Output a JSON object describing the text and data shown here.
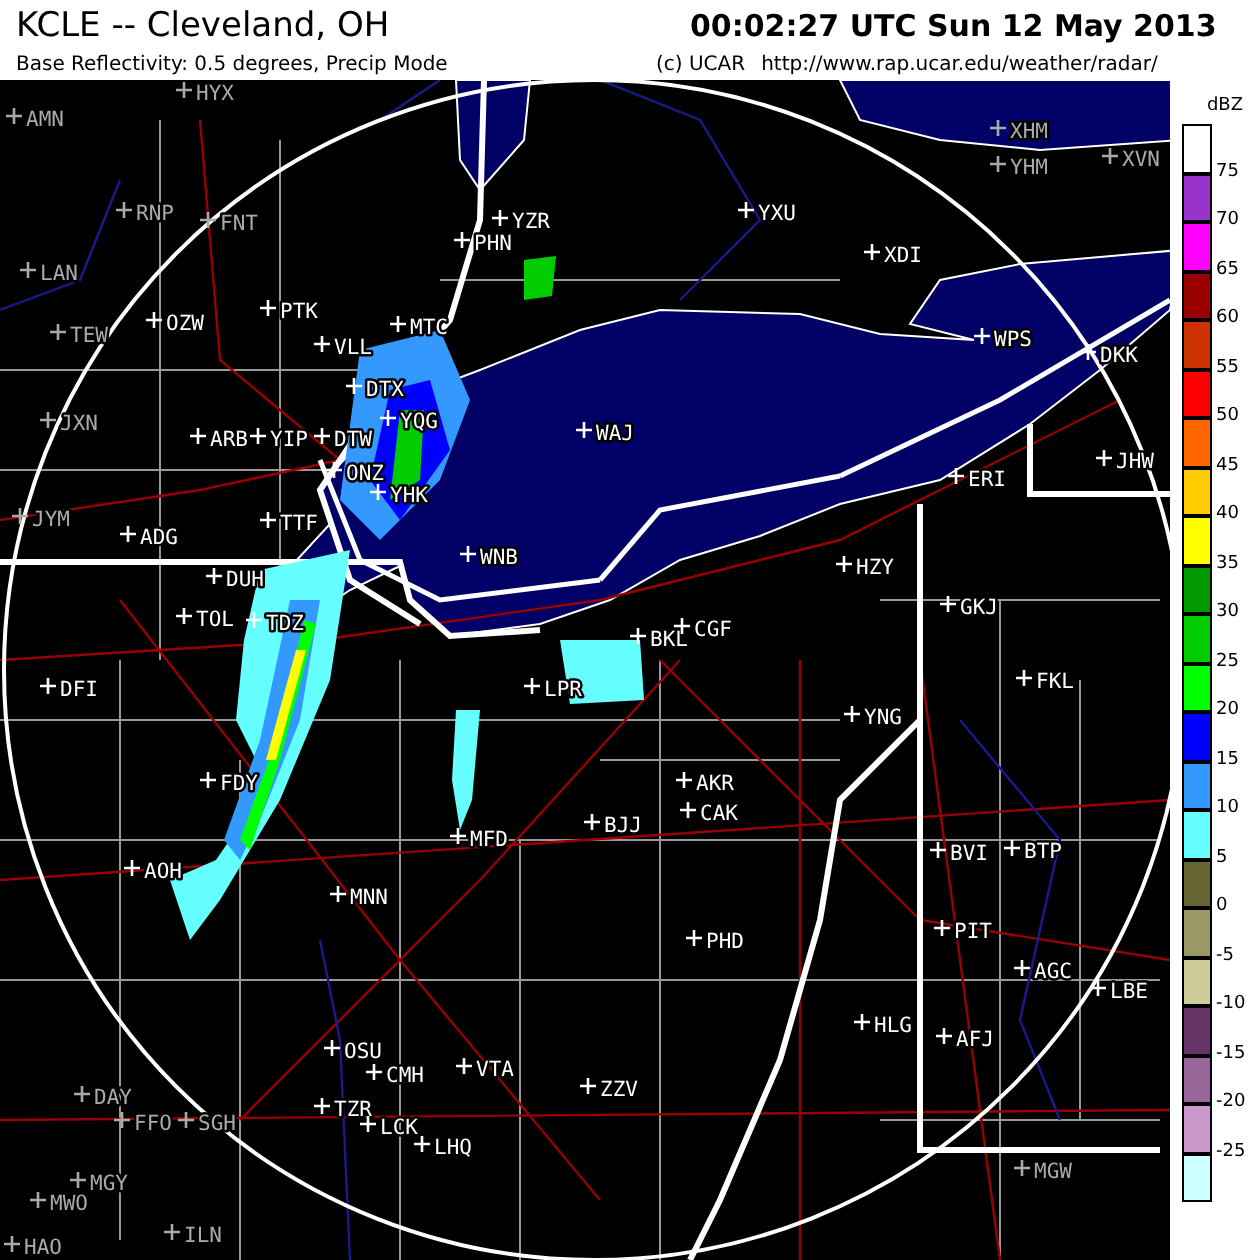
{
  "header": {
    "title": "KCLE -- Cleveland, OH",
    "timestamp": "00:02:27 UTC Sun 12 May 2013",
    "subtitle": "Base Reflectivity: 0.5 degrees, Precip Mode",
    "copyright": "(c) UCAR",
    "url": "http://www.rap.ucar.edu/weather/radar/"
  },
  "stations": [
    "HYX",
    "AMN",
    "RNP",
    "FNT",
    "LAN",
    "PTK",
    "TEW",
    "OZW",
    "VLL",
    "MTC",
    "DTX",
    "JXN",
    "ARB",
    "YIP",
    "DTW",
    "YQG",
    "ONZ",
    "YHK",
    "JYM",
    "ADG",
    "TTF",
    "WNB",
    "DUH",
    "TOL",
    "TDZ",
    "WAJ",
    "DFI",
    "LPR",
    "BKL",
    "CGF",
    "FDY",
    "MFD",
    "AOH",
    "MNN",
    "BJJ",
    "AKR",
    "CAK",
    "PHD",
    "OSU",
    "CMH",
    "VTA",
    "TZR",
    "LCK",
    "LHQ",
    "ZZV",
    "DAY",
    "FFO",
    "SGH",
    "MGY",
    "MWO",
    "ILN",
    "HAO",
    "YNG",
    "FKL",
    "BVI",
    "BTP",
    "PIT",
    "AGC",
    "LBE",
    "HLG",
    "AFJ",
    "MGW",
    "ERI",
    "HZY",
    "GKJ",
    "DKK",
    "JHW",
    "WPS",
    "XDI",
    "YXU",
    "YZR",
    "PHN",
    "XHM",
    "YHM",
    "XVN"
  ],
  "legend": {
    "unit": "dBZ",
    "items": [
      {
        "color": "#ffffff"
      },
      {
        "color": "#9933cc",
        "label": "75"
      },
      {
        "color": "#ff00ff",
        "label": "70"
      },
      {
        "color": "#990000",
        "label": "65"
      },
      {
        "color": "#cc3300",
        "label": "60"
      },
      {
        "color": "#ff0000",
        "label": "55"
      },
      {
        "color": "#ff6600",
        "label": "50"
      },
      {
        "color": "#ffcc00",
        "label": "45"
      },
      {
        "color": "#ffff00",
        "label": "40"
      },
      {
        "color": "#009900",
        "label": "35"
      },
      {
        "color": "#00cc00",
        "label": "30"
      },
      {
        "color": "#00ff00",
        "label": "25"
      },
      {
        "color": "#0000ff",
        "label": "20"
      },
      {
        "color": "#3399ff",
        "label": "15"
      },
      {
        "color": "#66ffff",
        "label": "10"
      },
      {
        "color": "#666633",
        "label": "5"
      },
      {
        "color": "#999966",
        "label": "0"
      },
      {
        "color": "#cccc99",
        "label": "-5"
      },
      {
        "color": "#663366",
        "label": "-10"
      },
      {
        "color": "#996699",
        "label": "-15"
      },
      {
        "color": "#cc99cc",
        "label": "-20"
      },
      {
        "color": "#ccffff",
        "label": "-25"
      }
    ]
  }
}
